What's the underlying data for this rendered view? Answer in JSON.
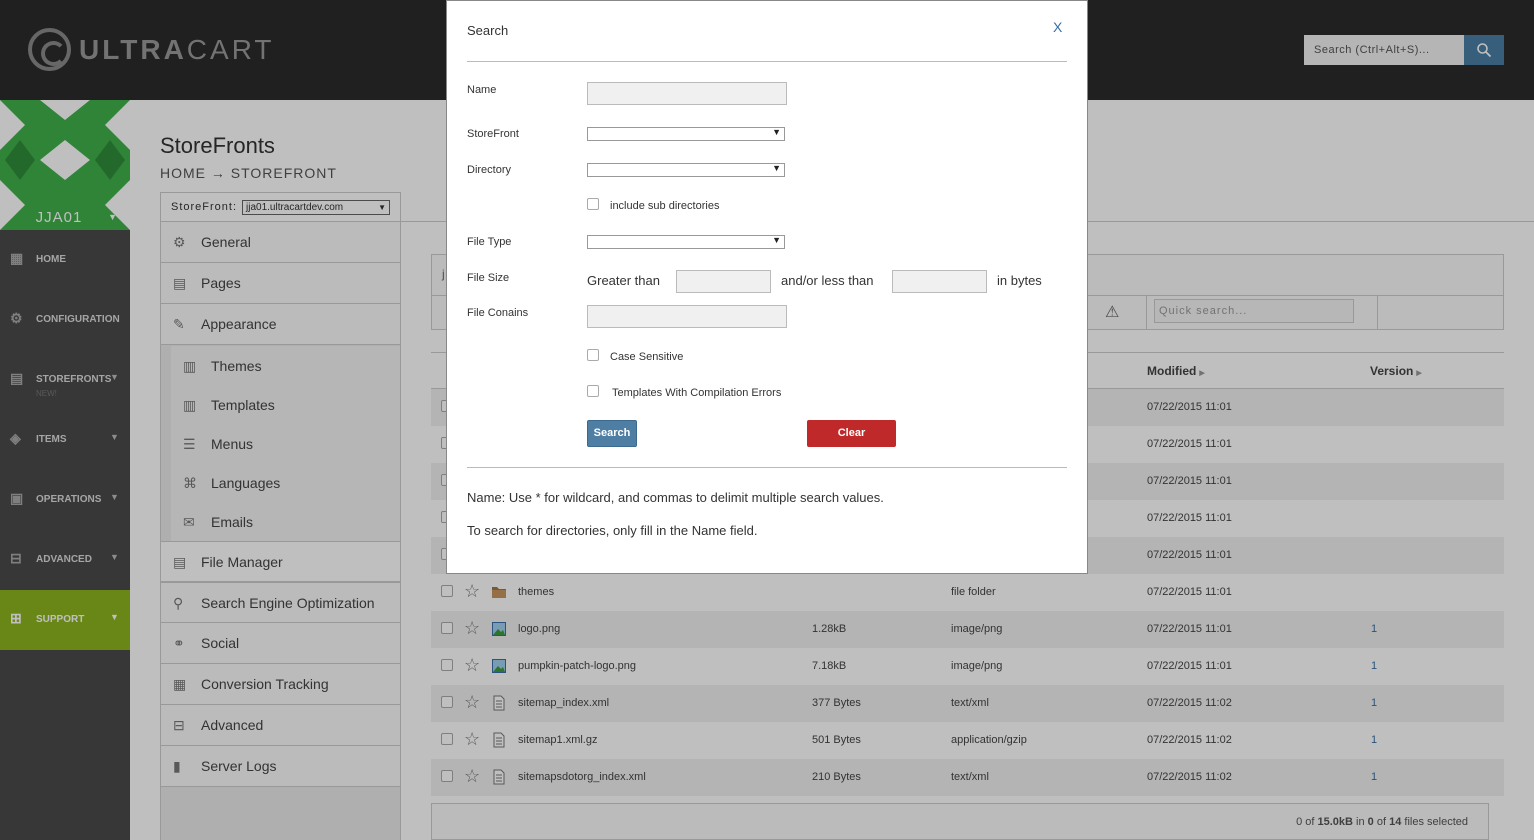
{
  "brand": {
    "name_bold": "ULTRA",
    "name_thin": "CART"
  },
  "top_search": {
    "placeholder": "Search (Ctrl+Alt+S)..."
  },
  "account": {
    "name": "JJA01"
  },
  "leftnav": [
    {
      "label": "HOME",
      "icon": "home-icon"
    },
    {
      "label": "CONFIGURATION",
      "icon": "gear-icon"
    },
    {
      "label": "STOREFRONTS",
      "icon": "store-icon",
      "sub": "NEW!"
    },
    {
      "label": "ITEMS",
      "icon": "cube-icon"
    },
    {
      "label": "OPERATIONS",
      "icon": "clipboard-icon"
    },
    {
      "label": "ADVANCED",
      "icon": "advanced-icon"
    },
    {
      "label": "SUPPORT",
      "icon": "plus-icon"
    }
  ],
  "page": {
    "title": "StoreFronts",
    "crumb_home": "HOME",
    "crumb_arrow": "→",
    "crumb_current": "STOREFRONT",
    "storefront_label": "StoreFront:",
    "storefront_value": "jja01.ultracartdev.com"
  },
  "menu": [
    {
      "label": "General"
    },
    {
      "label": "Pages"
    },
    {
      "label": "Appearance"
    },
    {
      "label": "Themes"
    },
    {
      "label": "Templates"
    },
    {
      "label": "Menus"
    },
    {
      "label": "Languages"
    },
    {
      "label": "Emails"
    },
    {
      "label": "File Manager"
    },
    {
      "label": "Search Engine Optimization"
    },
    {
      "label": "Social"
    },
    {
      "label": "Conversion Tracking"
    },
    {
      "label": "Advanced"
    },
    {
      "label": "Server Logs"
    }
  ],
  "table": {
    "quick_search_placeholder": "Quick search...",
    "partial_text": "j",
    "col_modified": "Modified",
    "col_version": "Version",
    "hidden_rows": [
      {
        "modified": "07/22/2015 11:01"
      },
      {
        "modified": "07/22/2015 11:01"
      },
      {
        "modified": "07/22/2015 11:01"
      },
      {
        "modified": "07/22/2015 11:01"
      },
      {
        "modified": "07/22/2015 11:01"
      }
    ],
    "rows": [
      {
        "name": "themes",
        "size": "",
        "type": "file folder",
        "modified": "07/22/2015 11:01",
        "version": ""
      },
      {
        "name": "logo.png",
        "size": "1.28kB",
        "type": "image/png",
        "modified": "07/22/2015 11:01",
        "version": "1"
      },
      {
        "name": "pumpkin-patch-logo.png",
        "size": "7.18kB",
        "type": "image/png",
        "modified": "07/22/2015 11:01",
        "version": "1"
      },
      {
        "name": "sitemap_index.xml",
        "size": "377 Bytes",
        "type": "text/xml",
        "modified": "07/22/2015 11:02",
        "version": "1"
      },
      {
        "name": "sitemap1.xml.gz",
        "size": "501 Bytes",
        "type": "application/gzip",
        "modified": "07/22/2015 11:02",
        "version": "1"
      },
      {
        "name": "sitemapsdotorg_index.xml",
        "size": "210 Bytes",
        "type": "text/xml",
        "modified": "07/22/2015 11:02",
        "version": "1"
      }
    ],
    "footer": {
      "a": "0 of ",
      "b": "15.0kB",
      "c": " in ",
      "d": "0",
      "e": " of ",
      "f": "14",
      "g": " files selected"
    }
  },
  "modal": {
    "title": "Search",
    "close": "X",
    "name_label": "Name",
    "name_value": "",
    "storefront_label": "StoreFront",
    "storefront_value": "",
    "directory_label": "Directory",
    "directory_value": "",
    "include_sub_label": "include sub directories",
    "filetype_label": "File Type",
    "filetype_value": "",
    "filesize_label": "File Size",
    "greater_than": "Greater than",
    "less_than": "and/or less than",
    "in_bytes": "in bytes",
    "contains_label": "File Conains",
    "case_label": "Case Sensitive",
    "templates_label": "Templates With Compilation Errors",
    "search_btn": "Search",
    "clear_btn": "Clear",
    "note1": "Name: Use * for wildcard, and commas to delimit multiple search values.",
    "note2": "To search for directories, only fill in the Name field."
  },
  "colors": {
    "accent": "#4f7ea4",
    "danger": "#c0292a",
    "support": "#8cb51f",
    "avatar": "#3fb04a"
  }
}
